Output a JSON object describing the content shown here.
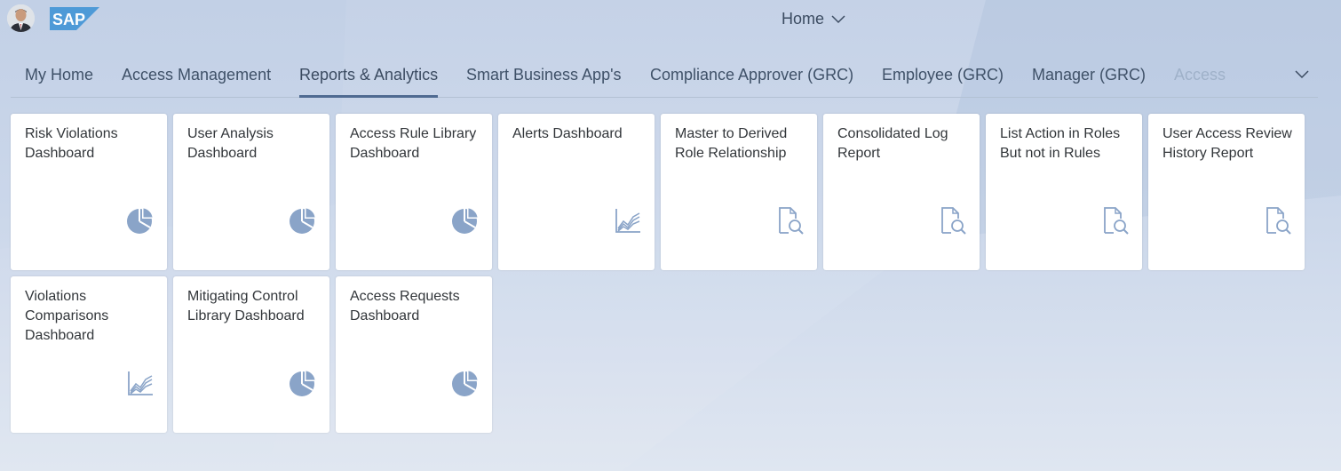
{
  "header": {
    "logo_text": "SAP",
    "title": "Home"
  },
  "tabs": [
    {
      "label": "My Home"
    },
    {
      "label": "Access Management"
    },
    {
      "label": "Reports & Analytics",
      "selected": true
    },
    {
      "label": "Smart Business App's"
    },
    {
      "label": "Compliance Approver (GRC)"
    },
    {
      "label": "Employee (GRC)"
    },
    {
      "label": "Manager (GRC)"
    },
    {
      "label": "Access"
    }
  ],
  "tiles": [
    {
      "title": "Risk Violations Dashboard",
      "icon": "pie-chart-icon"
    },
    {
      "title": "User Analysis Dashboard",
      "icon": "pie-chart-icon"
    },
    {
      "title": "Access Rule Library Dashboard",
      "icon": "pie-chart-icon"
    },
    {
      "title": "Alerts Dashboard",
      "icon": "line-chart-icon"
    },
    {
      "title": "Master to Derived Role Relationship",
      "icon": "document-search-icon"
    },
    {
      "title": "Consolidated Log Report",
      "icon": "document-search-icon"
    },
    {
      "title": "List Action in Roles But not in Rules",
      "icon": "document-search-icon"
    },
    {
      "title": "User Access Review History Report",
      "icon": "document-search-icon"
    },
    {
      "title": "Violations Comparisons Dashboard",
      "icon": "line-chart-icon"
    },
    {
      "title": "Mitigating Control Library Dashboard",
      "icon": "pie-chart-icon"
    },
    {
      "title": "Access Requests Dashboard",
      "icon": "pie-chart-icon"
    }
  ],
  "colors": {
    "icon": "#8aa4c8",
    "selected_tab_underline": "#4f6a91",
    "sap_blue": "#4e9ad7"
  }
}
